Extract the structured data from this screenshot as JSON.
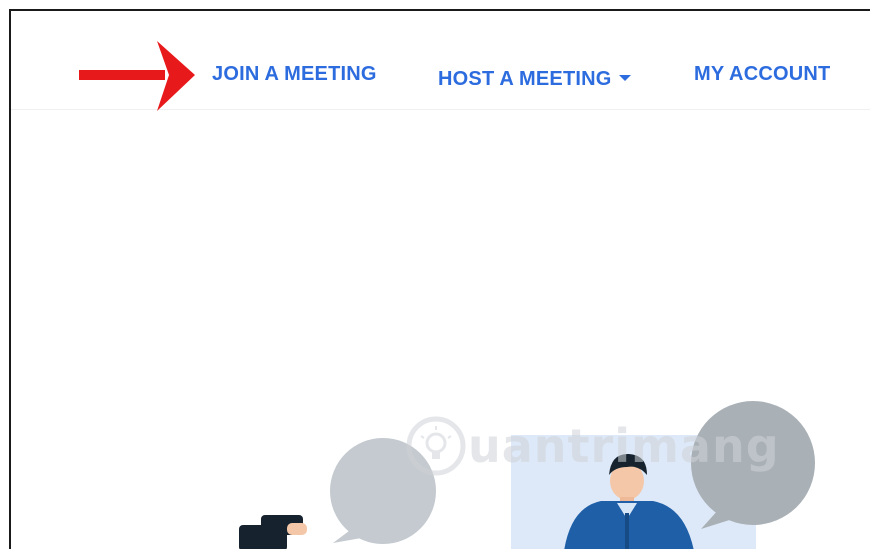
{
  "nav": {
    "join_label": "JOIN A MEETING",
    "host_label": "HOST A MEETING",
    "account_label": "MY ACCOUNT"
  },
  "watermark": {
    "text": "uantrimang",
    "icon": "lightbulb-icon"
  },
  "colors": {
    "link": "#2d6cdf",
    "annotation_arrow": "#e8191b",
    "speech_bubble": "#c4cacf",
    "speech_bubble_dark": "#a9b0b6",
    "video_panel": "#dde9f8",
    "person_shirt": "#1e5fa8"
  },
  "icons": [
    "red-arrow-icon",
    "caret-down-icon",
    "lightbulb-icon"
  ]
}
